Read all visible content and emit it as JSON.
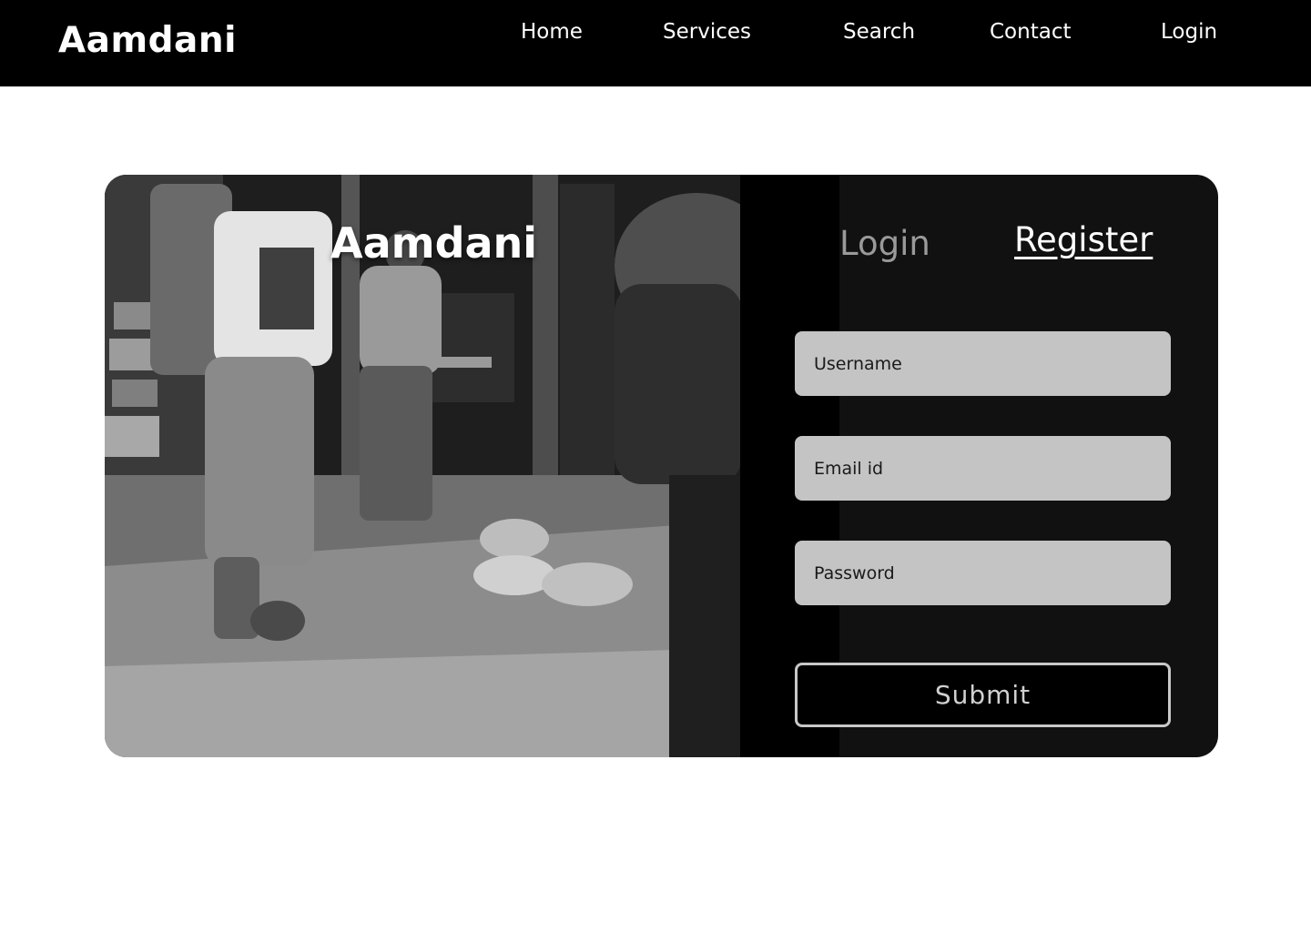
{
  "navbar": {
    "brand": "Aamdani",
    "links": [
      "Home",
      "Services",
      "Search",
      "Contact",
      "Login"
    ]
  },
  "hero": {
    "title": "Aamdani",
    "image_description": "black-and-white photo of porters carrying loads through a narrow market street"
  },
  "auth": {
    "tabs": {
      "login": "Login",
      "register": "Register",
      "active": "register"
    },
    "fields": {
      "username": {
        "value": "",
        "placeholder": "Username"
      },
      "email": {
        "value": "",
        "placeholder": "Email id"
      },
      "password": {
        "value": "",
        "placeholder": "Password"
      }
    },
    "submit_label": "Submit"
  },
  "colors": {
    "navbar_bg": "#000000",
    "card_bg": "#111111",
    "input_bg": "#c4c4c4",
    "inactive_tab": "#9a9a9a",
    "text_light": "#ffffff"
  }
}
